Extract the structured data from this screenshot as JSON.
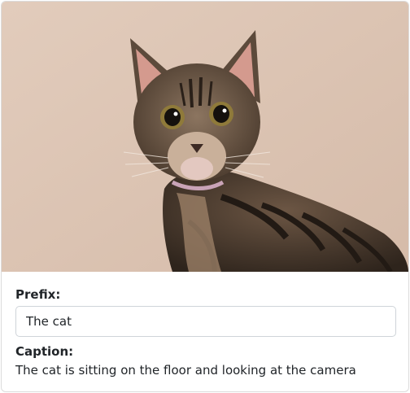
{
  "image": {
    "alt_name": "cat-photo",
    "colors": {
      "background": "#dcc3b2",
      "fur_dark": "#3b2f25",
      "fur_mid": "#7a6450",
      "fur_light": "#b39a82",
      "ear_inner": "#d49a8e",
      "eye": "#8f7a3a",
      "collar": "#c9a3b7"
    }
  },
  "form": {
    "prefix_label": "Prefix:",
    "prefix_value": "The cat",
    "caption_label": "Caption:",
    "caption_text": "The cat is sitting on the floor and looking at the camera"
  }
}
